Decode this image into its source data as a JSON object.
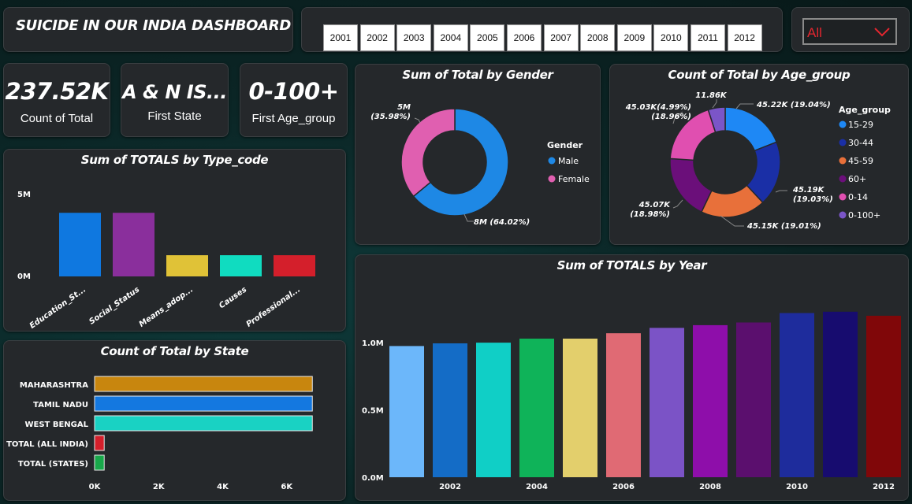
{
  "header": {
    "title": "SUICIDE IN OUR INDIA DASHBOARD"
  },
  "year_slicer": {
    "years": [
      "2001",
      "2002",
      "2003",
      "2004",
      "2005",
      "2006",
      "2007",
      "2008",
      "2009",
      "2010",
      "2011",
      "2012"
    ]
  },
  "dropdown": {
    "value": "All",
    "accent_color": "#e3262f"
  },
  "kpis": [
    {
      "value": "237.52K",
      "label": "Count of Total"
    },
    {
      "value": "A & N IS...",
      "label": "First State"
    },
    {
      "value": "0-100+",
      "label": "First Age_group"
    }
  ],
  "chart_data": [
    {
      "id": "type_code",
      "type": "bar",
      "title": "Sum of TOTALS by Type_code",
      "categories": [
        "Education_St...",
        "Social_Status",
        "Means_adop...",
        "Causes",
        "Professional..."
      ],
      "values": [
        4.8,
        4.8,
        1.6,
        1.6,
        1.6
      ],
      "colors": [
        "#0f78e0",
        "#8a2f9c",
        "#e0c237",
        "#10dcc0",
        "#d41f2b"
      ],
      "y_ticks": [
        "5M",
        "0M"
      ],
      "ylim": [
        0,
        6.3
      ],
      "unit": "M"
    },
    {
      "id": "state",
      "type": "bar",
      "orientation": "horizontal",
      "title": "Count of Total by State",
      "categories": [
        "MAHARASHTRA",
        "TAMIL NADU",
        "WEST BENGAL",
        "TOTAL (ALL INDIA)",
        "TOTAL (STATES)"
      ],
      "values": [
        6.8,
        6.8,
        6.8,
        0.3,
        0.3
      ],
      "colors": [
        "#c8860e",
        "#1478e0",
        "#19d2c3",
        "#d41f2b",
        "#18a84a"
      ],
      "x_ticks": [
        "0K",
        "2K",
        "4K",
        "6K"
      ],
      "xlim": [
        0,
        8
      ],
      "unit": "K"
    },
    {
      "id": "gender",
      "type": "pie",
      "style": "donut",
      "title": "Sum of Total by Gender",
      "legend_title": "Gender",
      "labels": [
        "Male",
        "Female"
      ],
      "values": [
        64.02,
        35.98
      ],
      "value_labels": [
        "8M (64.02%)",
        "5M\n(35.98%)"
      ],
      "colors": [
        "#1e88e5",
        "#e05fb0"
      ]
    },
    {
      "id": "age_group",
      "type": "pie",
      "style": "donut",
      "title": "Count of Total by Age_group",
      "legend_title": "Age_group",
      "labels": [
        "15-29",
        "30-44",
        "45-59",
        "60+",
        "0-14",
        "0-100+"
      ],
      "values": [
        19.04,
        19.03,
        19.01,
        18.98,
        18.96,
        4.99
      ],
      "value_labels": [
        "45.22K (19.04%)",
        "45.19K\n(19.03%)",
        "45.15K (19.01%)",
        "45.07K\n(18.98%)",
        "45.03K(4.99%)\n(18.96%)",
        "11.86K"
      ],
      "colors": [
        "#1e88f5",
        "#1a2fa6",
        "#e8703a",
        "#6b0f7a",
        "#e04fb0",
        "#7b55c8"
      ]
    },
    {
      "id": "year",
      "type": "bar",
      "title": "Sum of TOTALS by Year",
      "categories": [
        "2001",
        "2002",
        "2003",
        "2004",
        "2005",
        "2006",
        "2007",
        "2008",
        "2009",
        "2010",
        "2011",
        "2012"
      ],
      "values": [
        0.975,
        0.995,
        1.0,
        1.03,
        1.03,
        1.07,
        1.11,
        1.13,
        1.15,
        1.22,
        1.23,
        1.2
      ],
      "colors": [
        "#6cb7fa",
        "#146cc6",
        "#10cfc6",
        "#0fb359",
        "#e3cf6c",
        "#e06a74",
        "#7b53c6",
        "#8e0eaa",
        "#5b0f6e",
        "#1e2c9c",
        "#170c6f",
        "#800709"
      ],
      "x_tick_labels": [
        "2002",
        "2004",
        "2006",
        "2008",
        "2010",
        "2012"
      ],
      "y_ticks": [
        "1.0M",
        "0.5M",
        "0.0M"
      ],
      "ylim": [
        0,
        1.27
      ],
      "unit": "M"
    }
  ]
}
